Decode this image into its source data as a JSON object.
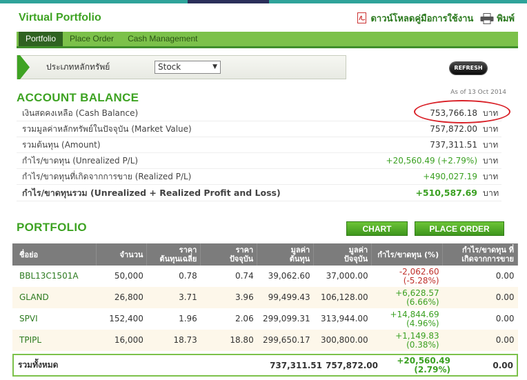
{
  "app": {
    "title": "Virtual Portfolio"
  },
  "header": {
    "manual_label": "ดาวน์โหลดคู่มือการใช้งาน",
    "print_label": "พิมพ์"
  },
  "tabs": [
    {
      "label": "Portfolio",
      "active": true
    },
    {
      "label": "Place Order",
      "active": false
    },
    {
      "label": "Cash Management",
      "active": false
    }
  ],
  "filter": {
    "label": "ประเภทหลักทรัพย์",
    "selected": "Stock"
  },
  "refresh_label": "REFRESH",
  "account": {
    "title": "ACCOUNT BALANCE",
    "as_of": "As of 13 Oct 2014",
    "unit": "บาท",
    "rows": [
      {
        "label": "เงินสดคงเหลือ (Cash Balance)",
        "value": "753,766.18"
      },
      {
        "label": "รวมมูลค่าหลักทรัพย์ในปัจจุบัน (Market Value)",
        "value": "757,872.00"
      },
      {
        "label": "รวมต้นทุน (Amount)",
        "value": "737,311.51"
      },
      {
        "label": "กำไร/ขาดทุน (Unrealized P/L)",
        "value": "+20,560.49 (+2.79%)"
      },
      {
        "label": "กำไร/ขาดทุนที่เกิดจากการขาย (Realized P/L)",
        "value": "+490,027.19"
      },
      {
        "label": "กำไร/ขาดทุนรวม (Unrealized + Realized Profit and Loss)",
        "value": "+510,587.69"
      }
    ]
  },
  "portfolio": {
    "title": "PORTFOLIO",
    "chart_label": "CHART",
    "place_order_label": "PLACE ORDER",
    "columns": [
      {
        "l1": "ชื่อย่อ",
        "l2": ""
      },
      {
        "l1": "จำนวน",
        "l2": ""
      },
      {
        "l1": "ราคา",
        "l2": "ต้นทุนเฉลี่ย"
      },
      {
        "l1": "ราคา",
        "l2": "ปัจจุบัน"
      },
      {
        "l1": "มูลค่า",
        "l2": "ต้นทุน"
      },
      {
        "l1": "มูลค่า",
        "l2": "ปัจจุบัน"
      },
      {
        "l1": "กำไร/ขาดทุน (%)",
        "l2": ""
      },
      {
        "l1": "กำไร/ขาดทุน ที่",
        "l2": "เกิดจากการขาย"
      }
    ],
    "rows": [
      {
        "symbol": "BBL13C1501A",
        "qty": "50,000",
        "avg_cost": "0.78",
        "price": "0.74",
        "cost_value": "39,062.60",
        "market_value": "37,000.00",
        "pl": "-2,062.60",
        "pl_pct": "(-5.28%)",
        "realized": "0.00"
      },
      {
        "symbol": "GLAND",
        "qty": "26,800",
        "avg_cost": "3.71",
        "price": "3.96",
        "cost_value": "99,499.43",
        "market_value": "106,128.00",
        "pl": "+6,628.57",
        "pl_pct": "(6.66%)",
        "realized": "0.00"
      },
      {
        "symbol": "SPVI",
        "qty": "152,400",
        "avg_cost": "1.96",
        "price": "2.06",
        "cost_value": "299,099.31",
        "market_value": "313,944.00",
        "pl": "+14,844.69",
        "pl_pct": "(4.96%)",
        "realized": "0.00"
      },
      {
        "symbol": "TPIPL",
        "qty": "16,000",
        "avg_cost": "18.73",
        "price": "18.80",
        "cost_value": "299,650.17",
        "market_value": "300,800.00",
        "pl": "+1,149.83",
        "pl_pct": "(0.38%)",
        "realized": "0.00"
      }
    ],
    "total": {
      "label": "รวมทั้งหมด",
      "cost_value": "737,311.51",
      "market_value": "757,872.00",
      "pl": "+20,560.49",
      "pl_pct": "(2.79%)",
      "realized": "0.00"
    }
  },
  "colors": {
    "brand_green": "#3ea323",
    "tab_green": "#7cc14a",
    "loss_red": "#c0312c",
    "highlight_oval": "#d92027"
  }
}
